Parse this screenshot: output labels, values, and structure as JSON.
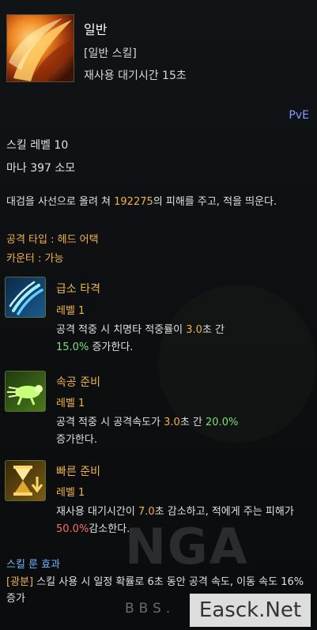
{
  "skill": {
    "name": "일반",
    "category": "[일반 스킬]",
    "cooldown": "재사용 대기시간 15초",
    "mode": "PvE",
    "level": "스킬 레벨 10",
    "mana": "마나 397 소모",
    "desc_pre": "대검을 사선으로 올려 쳐 ",
    "desc_damage": "192275",
    "desc_post": "의 피해를 주고, 적을 띄운다.",
    "attack_type": "공격 타입 : 헤드 어택",
    "counter": "카운터 : 가능"
  },
  "tripods": [
    {
      "name": "급소 타격",
      "level": "레벨 1",
      "icon": "claw-slash-icon",
      "d1": "공격 적중 시 치명타 적중률이 ",
      "v1": "3.0",
      "d2": "초 간",
      "v2": "15.0%",
      "d3": " 증가한다."
    },
    {
      "name": "속공 준비",
      "level": "레벨 1",
      "icon": "running-beast-icon",
      "d1": "공격 적중 시 공격속도가 ",
      "v1": "3.0",
      "d2": "초 간 ",
      "v2": "20.0%",
      "d3": "증가한다."
    },
    {
      "name": "빠른 준비",
      "level": "레벨 1",
      "icon": "hourglass-icon",
      "d1": "재사용 대기시간이 ",
      "v1": "7.0",
      "d2": "초 감소하고, 적에게 주는 피해가 ",
      "v2": "50.0%",
      "d3": "감소한다."
    }
  ],
  "rune": {
    "title": "스킬 룬 효과",
    "name": "[광분]",
    "desc": " 스킬 사용 시 일정 확률로 6초 동안 공격 속도, 이동 속도 16% 증가"
  },
  "watermark": {
    "logo": "NGA",
    "bbs": "BBS.",
    "site": "Easck.Net"
  },
  "colors": {
    "accent_gold": "#f0b24a",
    "positive": "#7be07b",
    "negative": "#ff6b6b",
    "pve": "#7f9dff",
    "rune_title": "#73b8ff"
  }
}
